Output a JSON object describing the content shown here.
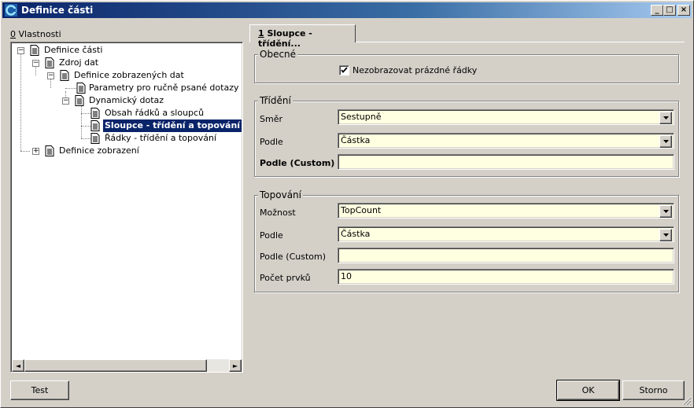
{
  "window": {
    "title": "Definice části",
    "controls": {
      "minimize": "_",
      "maximize": "□",
      "close": "×"
    }
  },
  "left": {
    "tab_label": "0 Vlastnosti",
    "tab_mnemonic": "0",
    "tab_rest": " Vlastnosti",
    "tree": [
      {
        "label": "Definice části",
        "expanded": true
      },
      {
        "label": "Zdroj dat",
        "expanded": true
      },
      {
        "label": "Definice zobrazených dat",
        "expanded": true
      },
      {
        "label": "Parametry pro ručně psané dotazy (SQL"
      },
      {
        "label": "Dynamický dotaz",
        "expanded": true
      },
      {
        "label": "Obsah řádků a sloupců"
      },
      {
        "label": "Sloupce - třídění a topování",
        "selected": true
      },
      {
        "label": "Řádky - třídění a topování"
      },
      {
        "label": "Definice zobrazení",
        "expanded": false
      }
    ],
    "scroll_left": "◄",
    "scroll_right": "►"
  },
  "right": {
    "tab_label": "1 Sloupce - třídění...",
    "tab_mnemonic": "1",
    "tab_rest": " Sloupce - třídění...",
    "general": {
      "title": "Obecné",
      "hide_empty_rows_label": "Nezobrazovat prázdné řádky",
      "hide_empty_rows_checked": true
    },
    "sorting": {
      "title": "Třídění",
      "direction_label": "Směr",
      "direction_value": "Sestupně",
      "by_label": "Podle",
      "by_value": "Částka",
      "custom_label": "Podle (Custom)",
      "custom_value": ""
    },
    "topping": {
      "title": "Topování",
      "option_label": "Možnost",
      "option_value": "TopCount",
      "by_label": "Podle",
      "by_value": "Částka",
      "custom_label": "Podle (Custom)",
      "custom_value": "",
      "count_label": "Počet prvků",
      "count_value": "10"
    }
  },
  "buttons": {
    "test": "Test",
    "ok": "OK",
    "cancel": "Storno"
  },
  "colors": {
    "title_bar": "#0a246a",
    "field_background": "#ffffe1",
    "selection": "#0a246a",
    "face": "#d4d0c8"
  }
}
